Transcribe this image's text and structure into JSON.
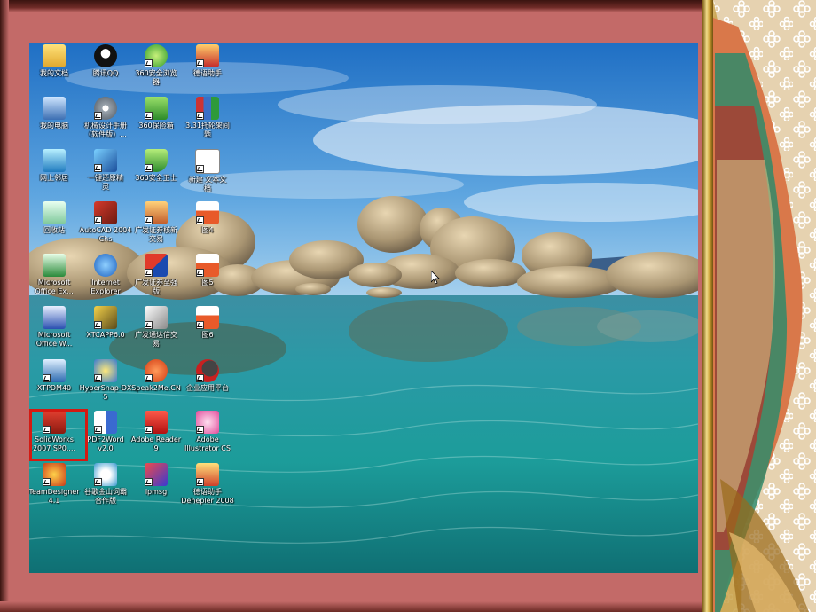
{
  "colors": {
    "frame": "#c36a68",
    "highlight": "#d41a12",
    "label": "#ffffff"
  },
  "desktop": {
    "icons": [
      {
        "label": "我的文档",
        "icon": "folder-documents-icon"
      },
      {
        "label": "腾讯QQ",
        "icon": "qq-penguin-icon"
      },
      {
        "label": "360安全浏览\n器",
        "icon": "browser-360-icon"
      },
      {
        "label": "德语助手",
        "icon": "german-helper-icon"
      },
      {
        "label": "我的电脑",
        "icon": "my-computer-icon"
      },
      {
        "label": "机械设计手册\n（软件版）...",
        "icon": "manual-disc-icon"
      },
      {
        "label": "360保险箱",
        "icon": "safe-360-icon"
      },
      {
        "label": "3.31托轮架间\n题",
        "icon": "winrar-icon"
      },
      {
        "label": "网上邻居",
        "icon": "network-icon"
      },
      {
        "label": "一键还原精\n灵",
        "icon": "restore-icon"
      },
      {
        "label": "360安全卫士",
        "icon": "shield-360-icon"
      },
      {
        "label": "新建 文本文\n档",
        "icon": "text-file-icon"
      },
      {
        "label": "回收站",
        "icon": "recycle-bin-icon"
      },
      {
        "label": "AutoCAD 2004\nChs",
        "icon": "autocad-icon"
      },
      {
        "label": "广发证券核新\n交易",
        "icon": "house-trade-icon"
      },
      {
        "label": "图4",
        "icon": "image-file-icon"
      },
      {
        "label": "Microsoft\nOffice Ex...",
        "icon": "excel-icon"
      },
      {
        "label": "Internet\nExplorer",
        "icon": "ie-icon"
      },
      {
        "label": "广发证券至强\n版",
        "icon": "gf-securities-icon"
      },
      {
        "label": "图5",
        "icon": "image-file-icon"
      },
      {
        "label": "Microsoft\nOffice W...",
        "icon": "word-icon"
      },
      {
        "label": "XTCAPP6.0",
        "icon": "xtcapp-icon"
      },
      {
        "label": "广发通达信交\n易",
        "icon": "tdx-trade-icon"
      },
      {
        "label": "图6",
        "icon": "image-file-icon"
      },
      {
        "label": "XTPDM40",
        "icon": "xtpdm-icon"
      },
      {
        "label": "HyperSnap-DX\n5",
        "icon": "hypersnap-icon"
      },
      {
        "label": "Speak2Me.CN",
        "icon": "speak2me-icon"
      },
      {
        "label": "企业应用平台",
        "icon": "enterprise-platform-icon"
      },
      {
        "label": "SolidWorks\n2007 SP0....",
        "icon": "solidworks-icon"
      },
      {
        "label": "PDF2Word\nv2.0",
        "icon": "pdf2word-icon"
      },
      {
        "label": "Adobe Reader\n9",
        "icon": "adobe-reader-icon"
      },
      {
        "label": "Adobe\nIllustrator CS",
        "icon": "illustrator-icon"
      },
      {
        "label": "TeamDesigner\n4.1",
        "icon": "teamdesigner-icon"
      },
      {
        "label": "谷歌金山词霸\n合作版",
        "icon": "ciba-icon"
      },
      {
        "label": "ipmsg",
        "icon": "ipmsg-icon"
      },
      {
        "label": "德语助手\nDehepler 2008",
        "icon": "dehelper-icon"
      }
    ]
  }
}
